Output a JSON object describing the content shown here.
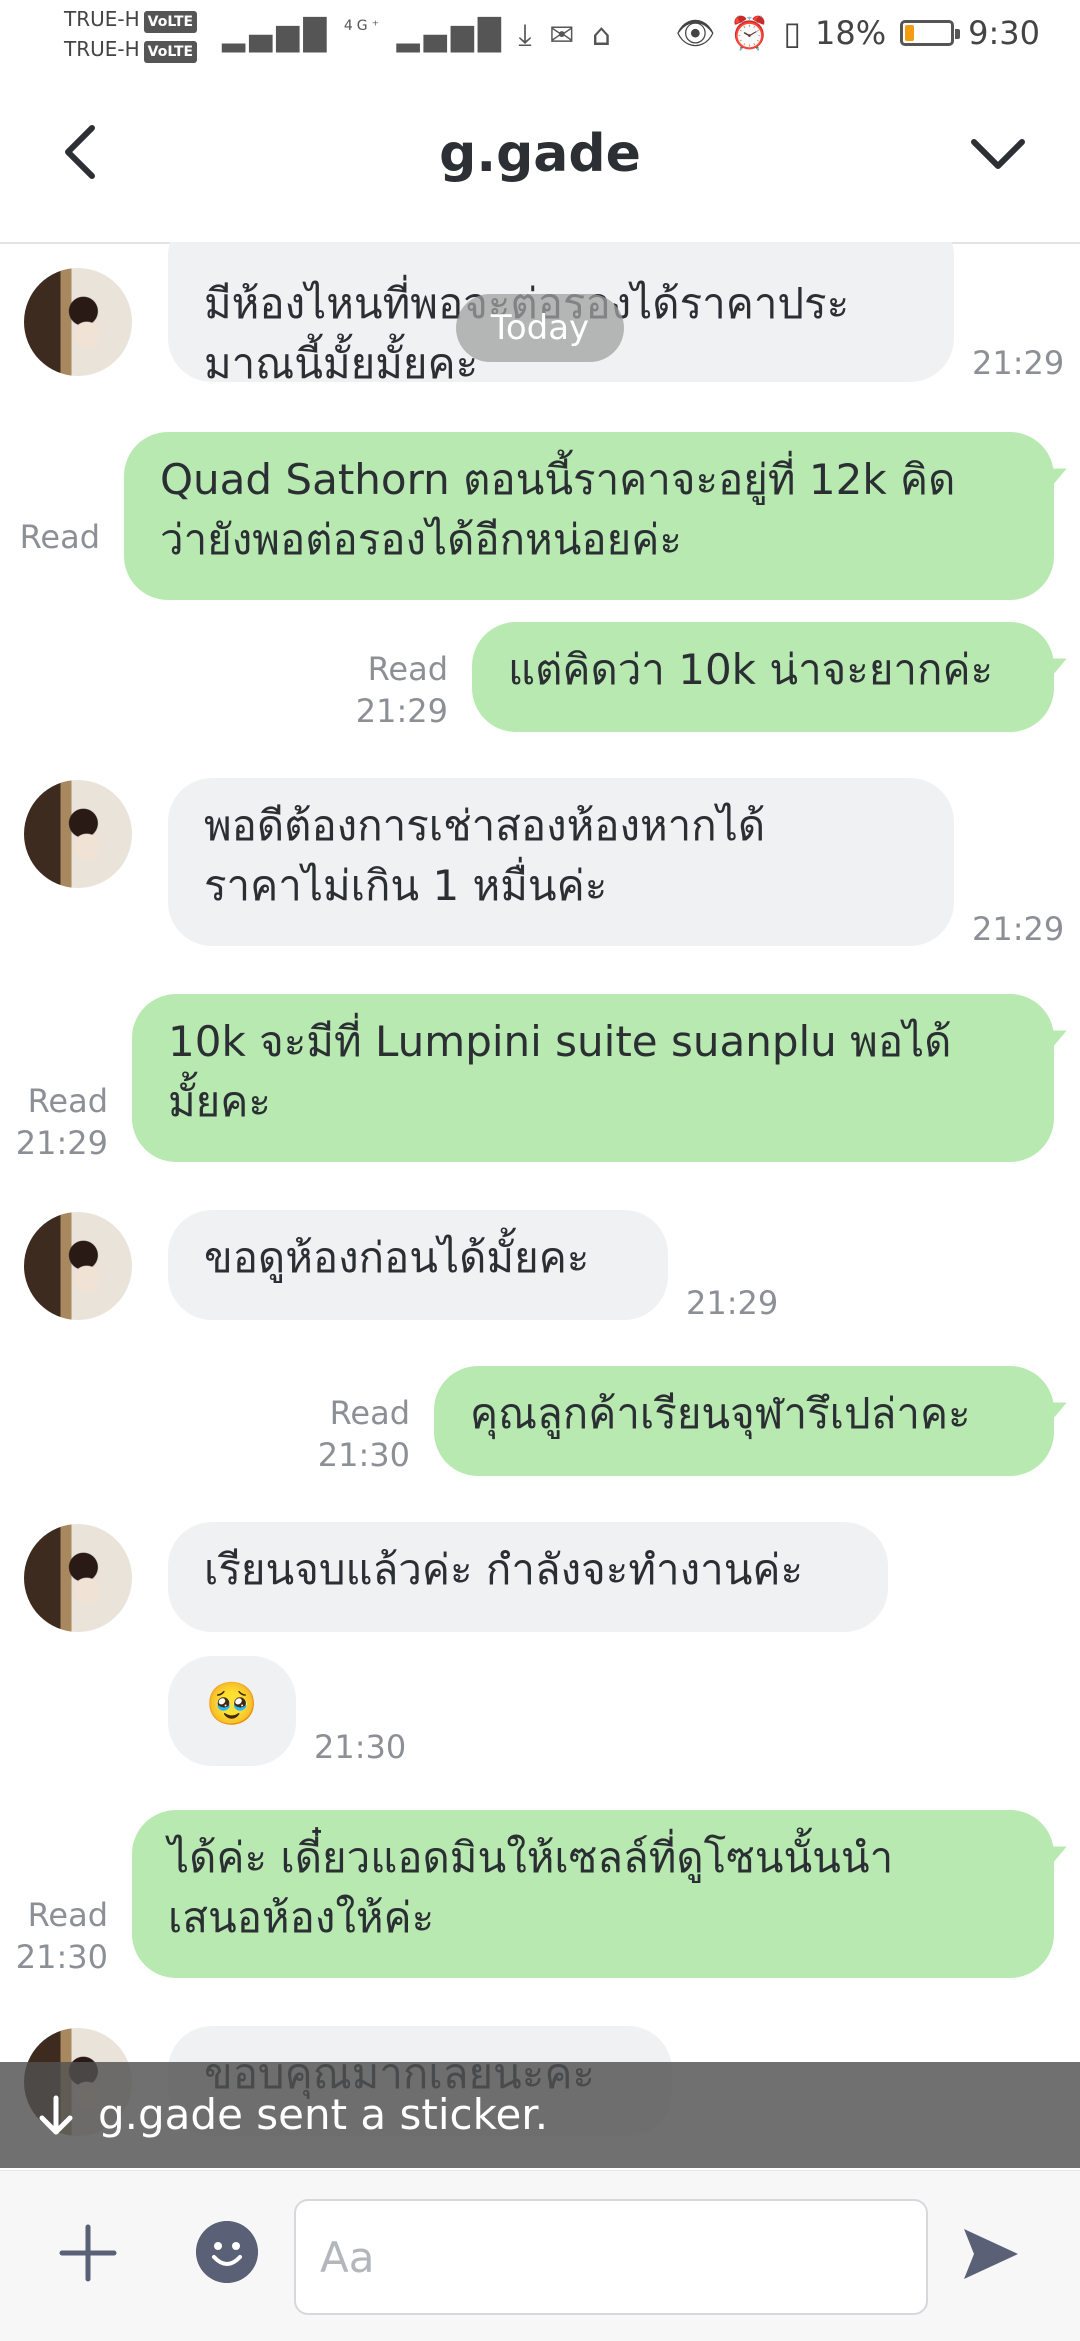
{
  "status_bar": {
    "carrier1": "TRUE-H",
    "carrier2": "TRUE-H",
    "volte": "VoLTE",
    "network": "4G⁺",
    "battery_text": "18%",
    "battery_level": 0.18,
    "time": "9:30"
  },
  "header": {
    "title": "g.gade"
  },
  "date_separator": "Today",
  "messages": [
    {
      "from": "contact",
      "lines": [
        "มีห้องไหนที่พอจะต่อรองได้ราคาประ",
        "มาณนี้มั้ยมั้ยคะ"
      ],
      "time": "21:29"
    },
    {
      "from": "me",
      "lines": [
        "Quad Sathorn ตอนนี้ราคาจะอยู่ที่ 12k คิด",
        "ว่ายังพอต่อรองได้อีกหน่อยค่ะ"
      ],
      "read": "Read",
      "time": ""
    },
    {
      "from": "me",
      "lines": [
        "แต่คิดว่า 10k น่าจะยากค่ะ"
      ],
      "read": "Read",
      "time": "21:29"
    },
    {
      "from": "contact",
      "lines": [
        "พอดีต้องการเช่าสองห้องหากได้",
        "ราคาไม่เกิน 1 หมื่นค่ะ"
      ],
      "time": "21:29"
    },
    {
      "from": "me",
      "lines": [
        "10k จะมีที่ Lumpini suite suanplu พอได้",
        "มั้ยคะ"
      ],
      "read": "Read",
      "time": "21:29"
    },
    {
      "from": "contact",
      "lines": [
        "ขอดูห้องก่อนได้มั้ยคะ"
      ],
      "time": "21:29"
    },
    {
      "from": "me",
      "lines": [
        "คุณลูกค้าเรียนจุฬารึเปล่าคะ"
      ],
      "read": "Read",
      "time": "21:30"
    },
    {
      "from": "contact",
      "lines": [
        "เรียนจบแล้วค่ะ กำลังจะทำงานค่ะ"
      ],
      "time": ""
    },
    {
      "from": "contact",
      "lines": [
        "🥹"
      ],
      "time": "21:30"
    },
    {
      "from": "me",
      "lines": [
        "ได้ค่ะ เดี๋ยวแอดมินให้เซลล์ที่ดูโซนนั้นนำ",
        "เสนอห้องให้ค่ะ"
      ],
      "read": "Read",
      "time": "21:30"
    },
    {
      "from": "contact",
      "lines": [
        "ขอบคุณมากเลยนะคะ"
      ],
      "time": ""
    }
  ],
  "notification": {
    "text": "g.gade sent a sticker."
  },
  "input": {
    "placeholder": "Aa"
  },
  "colors": {
    "outgoing_bubble": "#b8e9b1",
    "incoming_bubble": "#f0f1f3",
    "icon": "#5a6177"
  }
}
